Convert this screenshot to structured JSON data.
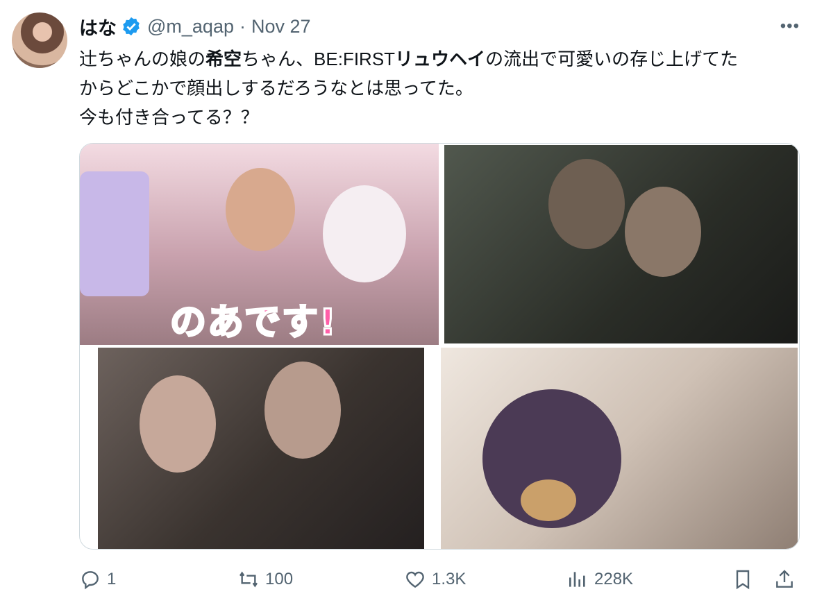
{
  "author": {
    "display_name": "はな",
    "handle": "@m_aqap",
    "separator": "·",
    "date": "Nov 27"
  },
  "more_label": "•••",
  "tweet_lines": [
    [
      "辻ちゃんの娘の",
      "希空",
      "ちゃん、BE:FIRST",
      "リュウヘイ",
      "の流出で可愛いの存じ上げてた"
    ],
    "からどこかで顔出しするだろうなとは思ってた。",
    "今も付き合ってる？？"
  ],
  "media": {
    "image1_caption": "のあです!"
  },
  "actions": {
    "replies": "1",
    "reposts": "100",
    "likes": "1.3K",
    "views": "228K"
  },
  "colors": {
    "text": "#0f1419",
    "secondary": "#536471",
    "verified": "#1d9bf0",
    "border": "#cfd9de"
  },
  "icons": {
    "reply": "reply-icon",
    "repost": "repost-icon",
    "like": "heart-icon",
    "views": "views-icon",
    "bookmark": "bookmark-icon",
    "share": "share-icon",
    "verified": "verified-badge-icon"
  }
}
